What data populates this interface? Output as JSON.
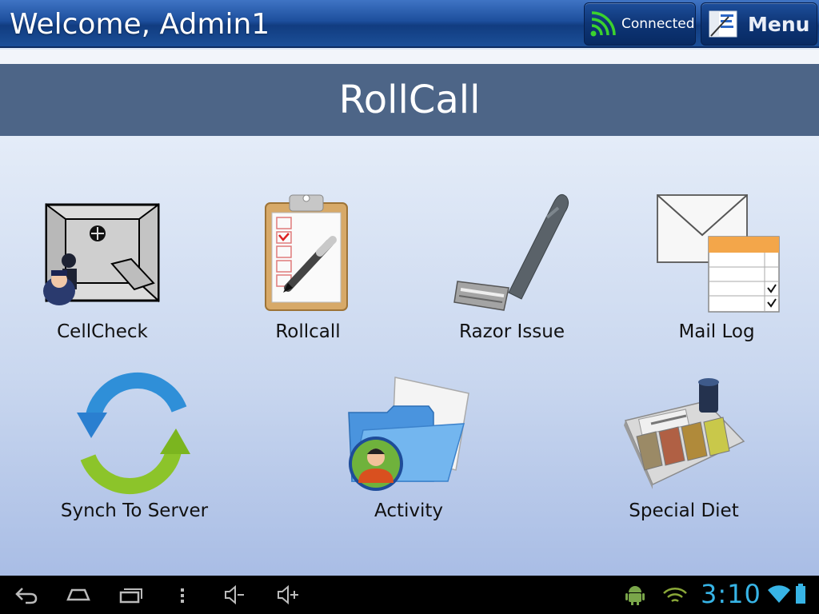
{
  "header": {
    "welcome": "Welcome, Admin1",
    "connected_label": "Connected",
    "menu_label": "Menu",
    "connected_icon": "wifi-signal-icon",
    "menu_icon": "menu-icon"
  },
  "page": {
    "title": "RollCall"
  },
  "tiles": [
    {
      "label": "CellCheck",
      "icon": "cell-check-icon"
    },
    {
      "label": "Rollcall",
      "icon": "clipboard-icon"
    },
    {
      "label": "Razor Issue",
      "icon": "razor-icon"
    },
    {
      "label": "Mail Log",
      "icon": "mail-log-icon"
    },
    {
      "label": "Synch To Server",
      "icon": "sync-icon"
    },
    {
      "label": "Activity",
      "icon": "folder-user-icon"
    },
    {
      "label": "Special Diet",
      "icon": "food-tray-icon"
    }
  ],
  "statusbar": {
    "time": "3:10",
    "nav_icons": [
      "back-icon",
      "home-icon",
      "recent-apps-icon",
      "overflow-menu-icon",
      "volume-down-icon",
      "volume-up-icon"
    ],
    "status_icons": [
      "android-icon",
      "wifi-signal-icon",
      "wifi-icon",
      "battery-icon"
    ]
  },
  "colors": {
    "topbar": "#1d4f9d",
    "title_band": "#4d6587",
    "clock": "#37b4e6"
  }
}
